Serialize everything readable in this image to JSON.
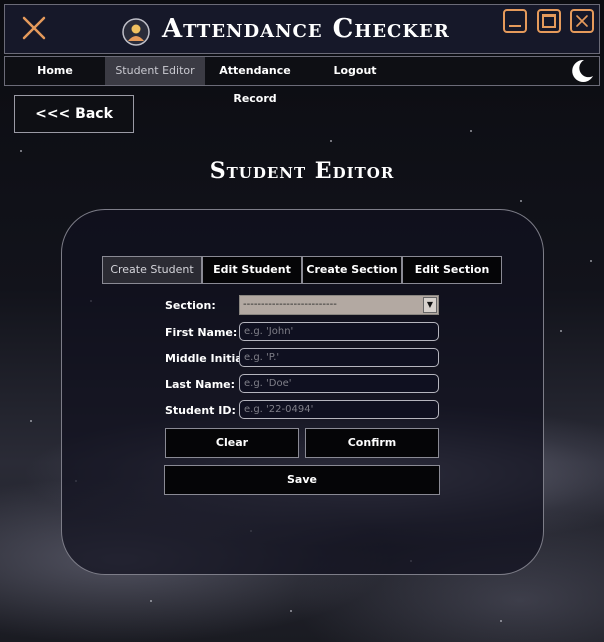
{
  "window": {
    "title": "Attendance Checker",
    "icons": {
      "close": "close-icon",
      "logo": "app-logo-icon",
      "minimize": "minimize-icon",
      "maximize": "maximize-icon",
      "window_close": "window-close-icon",
      "theme": "moon-icon"
    },
    "accent_color": "#e59a5b"
  },
  "nav": {
    "items": [
      {
        "label": "Home",
        "active": false
      },
      {
        "label": "Student Editor",
        "active": true
      },
      {
        "label": "Attendance Record",
        "active": false
      },
      {
        "label": "Logout",
        "active": false
      }
    ]
  },
  "back_button": {
    "label": "<<< Back"
  },
  "page_title": "Student Editor",
  "tabs": [
    {
      "label": "Create Student",
      "active": true
    },
    {
      "label": "Edit Student",
      "active": false
    },
    {
      "label": "Create Section",
      "active": false
    },
    {
      "label": "Edit Section",
      "active": false
    }
  ],
  "form": {
    "section": {
      "label": "Section:",
      "value": "--------------------------"
    },
    "first_name": {
      "label": "First Name:",
      "placeholder": "e.g. 'John'"
    },
    "middle_initial": {
      "label": "Middle Initial:",
      "placeholder": "e.g. 'P.'"
    },
    "last_name": {
      "label": "Last Name:",
      "placeholder": "e.g. 'Doe'"
    },
    "student_id": {
      "label": "Student ID:",
      "placeholder": "e.g. '22-0494'"
    }
  },
  "buttons": {
    "clear": "Clear",
    "confirm": "Confirm",
    "save": "Save"
  }
}
